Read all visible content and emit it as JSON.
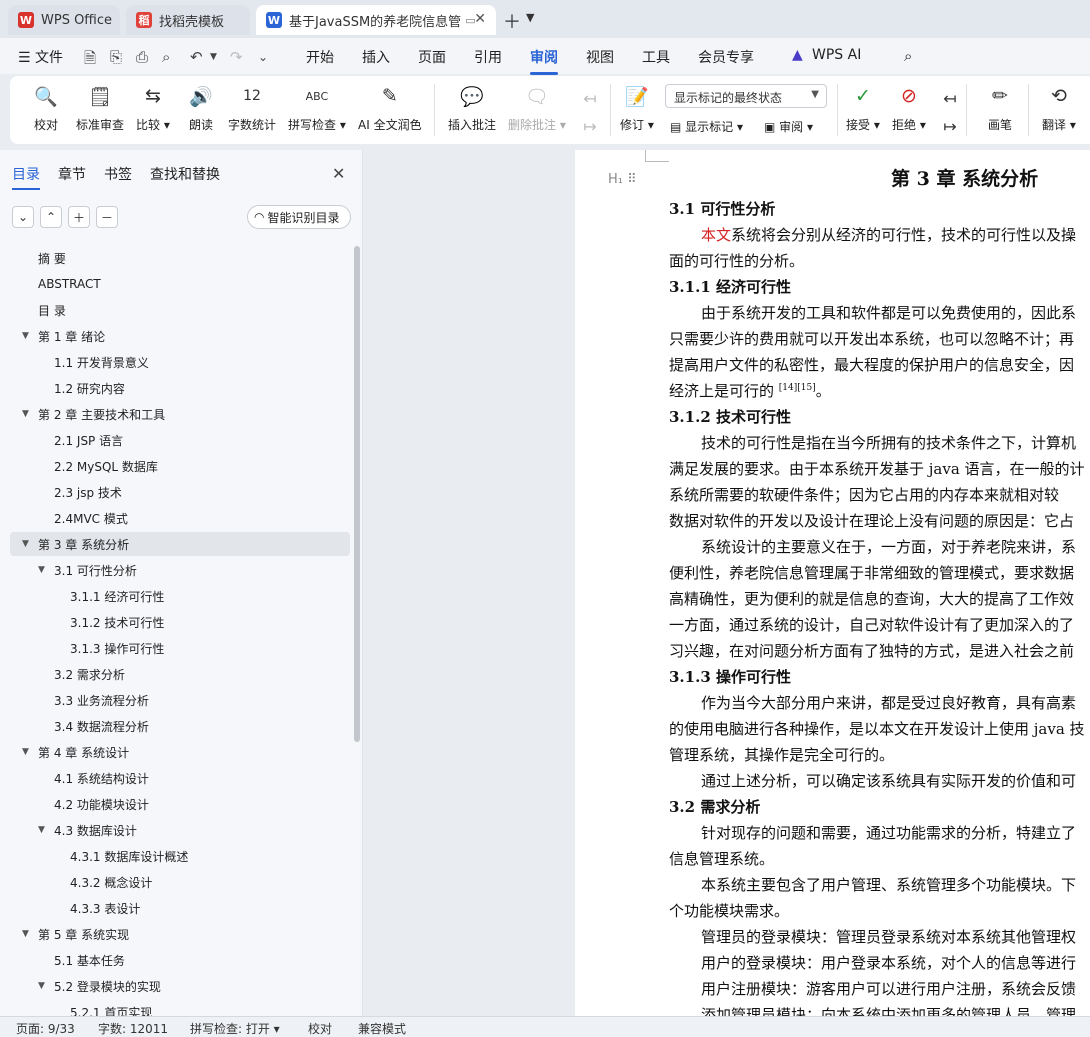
{
  "tabs": [
    {
      "label": "WPS Office",
      "logo": "W",
      "color": "#d8322d"
    },
    {
      "label": "找稻壳模板",
      "logo": "稻",
      "color": "#e0423b"
    },
    {
      "label": "基于JavaSSM的养老院信息管",
      "logo": "W",
      "color": "#2a64d6"
    }
  ],
  "menu": {
    "file": "文件",
    "items": [
      "开始",
      "插入",
      "页面",
      "引用",
      "审阅",
      "视图",
      "工具",
      "会员专享"
    ],
    "active": "审阅",
    "ai": "WPS AI"
  },
  "ribbon": {
    "proof": "校对",
    "std_review": "标准审查",
    "compare": "比较",
    "read": "朗读",
    "wordcount": "字数统计",
    "spell": "拼写检查",
    "ai_polish": "AI 全文润色",
    "insert_comment": "插入批注",
    "delete_comment": "删除批注",
    "revise": "修订",
    "display_select": "显示标记的最终状态",
    "show_markup": "显示标记",
    "review": "审阅",
    "accept": "接受",
    "reject": "拒绝",
    "pen": "画笔",
    "translate": "翻译"
  },
  "sidebar": {
    "tabs": [
      "目录",
      "章节",
      "书签",
      "查找和替换"
    ],
    "smart_toc": "智能识别目录",
    "toc": [
      {
        "label": "摘  要",
        "level": 1,
        "toggle": ""
      },
      {
        "label": "ABSTRACT",
        "level": 1,
        "toggle": ""
      },
      {
        "label": "目  录",
        "level": 1,
        "toggle": ""
      },
      {
        "label": "第 1 章  绪论",
        "level": 1,
        "toggle": "▼"
      },
      {
        "label": "1.1 开发背景意义",
        "level": 2,
        "toggle": ""
      },
      {
        "label": "1.2 研究内容",
        "level": 2,
        "toggle": ""
      },
      {
        "label": "第 2 章  主要技术和工具",
        "level": 1,
        "toggle": "▼"
      },
      {
        "label": "2.1 JSP 语言",
        "level": 2,
        "toggle": ""
      },
      {
        "label": "2.2 MySQL 数据库",
        "level": 2,
        "toggle": ""
      },
      {
        "label": "2.3 jsp 技术",
        "level": 2,
        "toggle": ""
      },
      {
        "label": "2.4MVC 模式",
        "level": 2,
        "toggle": ""
      },
      {
        "label": "第 3 章  系统分析",
        "level": 1,
        "toggle": "▼",
        "selected": true
      },
      {
        "label": "3.1 可行性分析",
        "level": 2,
        "toggle": "▼"
      },
      {
        "label": "3.1.1 经济可行性",
        "level": 3,
        "toggle": ""
      },
      {
        "label": "3.1.2 技术可行性",
        "level": 3,
        "toggle": ""
      },
      {
        "label": "3.1.3 操作可行性",
        "level": 3,
        "toggle": ""
      },
      {
        "label": "3.2 需求分析",
        "level": 2,
        "toggle": ""
      },
      {
        "label": "3.3 业务流程分析",
        "level": 2,
        "toggle": ""
      },
      {
        "label": "3.4 数据流程分析",
        "level": 2,
        "toggle": ""
      },
      {
        "label": "第 4 章  系统设计",
        "level": 1,
        "toggle": "▼"
      },
      {
        "label": "4.1 系统结构设计",
        "level": 2,
        "toggle": ""
      },
      {
        "label": "4.2 功能模块设计",
        "level": 2,
        "toggle": ""
      },
      {
        "label": "4.3 数据库设计",
        "level": 2,
        "toggle": "▼"
      },
      {
        "label": "4.3.1 数据库设计概述",
        "level": 3,
        "toggle": ""
      },
      {
        "label": "4.3.2 概念设计",
        "level": 3,
        "toggle": ""
      },
      {
        "label": "4.3.3 表设计",
        "level": 3,
        "toggle": ""
      },
      {
        "label": "第 5 章   系统实现",
        "level": 1,
        "toggle": "▼"
      },
      {
        "label": "5.1 基本任务",
        "level": 2,
        "toggle": ""
      },
      {
        "label": "5.2 登录模块的实现",
        "level": 2,
        "toggle": "▼"
      },
      {
        "label": "5.2.1 首页实现",
        "level": 3,
        "toggle": ""
      }
    ]
  },
  "doc": {
    "chapter": "第 3 章  系统分析",
    "lines": [
      {
        "t": "3.1 可行性分析",
        "c": "h2"
      },
      {
        "t": "系统将会分别从经济的可行性，技术的可行性以及操",
        "red": "本文",
        "indent": true
      },
      {
        "t": "面的可行性的分析。"
      },
      {
        "t": "3.1.1 经济可行性",
        "c": "h3"
      },
      {
        "t": "由于系统开发的工具和软件都是可以免费使用的，因此系",
        "indent": true
      },
      {
        "t": "只需要少许的费用就可以开发出本系统，也可以忽略不计；再"
      },
      {
        "t": "提高用户文件的私密性，最大程度的保护用户的信息安全，因"
      },
      {
        "t": "经济上是可行的 ",
        "sup": "[14][15]",
        "tail": "。"
      },
      {
        "t": "3.1.2 技术可行性",
        "c": "h3"
      },
      {
        "t": "技术的可行性是指在当今所拥有的技术条件之下，计算机",
        "indent": true
      },
      {
        "t": "满足发展的要求。由于本系统开发基于 java 语言，在一般的计"
      },
      {
        "t": "系统所需要的软硬件条件；因为它占用的内存本来就相对较"
      },
      {
        "t": "数据对软件的开发以及设计在理论上没有问题的原因是：它占"
      },
      {
        "t": "系统设计的主要意义在于，一方面，对于养老院来讲，系",
        "indent": true
      },
      {
        "t": "便利性，养老院信息管理属于非常细致的管理模式，要求数据"
      },
      {
        "t": "高精确性，更为便利的就是信息的查询，大大的提高了工作效"
      },
      {
        "t": "一方面，通过系统的设计，自己对软件设计有了更加深入的了"
      },
      {
        "t": "习兴趣，在对问题分析方面有了独特的方式，是进入社会之前"
      },
      {
        "t": "3.1.3 操作可行性",
        "c": "h3"
      },
      {
        "t": "作为当今大部分用户来讲，都是受过良好教育，具有高素",
        "indent": true
      },
      {
        "t": "的使用电脑进行各种操作，是以本文在开发设计上使用 java 技"
      },
      {
        "t": "管理系统，其操作是完全可行的。"
      },
      {
        "t": "通过上述分析，可以确定该系统具有实际开发的价值和可",
        "indent": true
      },
      {
        "t": "3.2 需求分析",
        "c": "h2"
      },
      {
        "t": "针对现存的问题和需要，通过功能需求的分析，特建立了",
        "indent": true
      },
      {
        "t": "信息管理系统。"
      },
      {
        "t": "本系统主要包含了用户管理、系统管理多个功能模块。下",
        "indent": true
      },
      {
        "t": "个功能模块需求。"
      },
      {
        "t": "管理员的登录模块：管理员登录系统对本系统其他管理权",
        "indent": true
      },
      {
        "t": "用户的登录模块：用户登录本系统，对个人的信息等进行",
        "indent": true
      },
      {
        "t": "用户注册模块：游客用户可以进行用户注册，系统会反馈",
        "indent": true
      },
      {
        "t": "添加管理员模块：向本系统中添加更多的管理人员，管理",
        "indent": true
      }
    ]
  },
  "status": {
    "page": "页面: 9/33",
    "words": "字数: 12011",
    "spell": "拼写检查: 打开",
    "proof": "校对",
    "compat": "兼容模式"
  }
}
